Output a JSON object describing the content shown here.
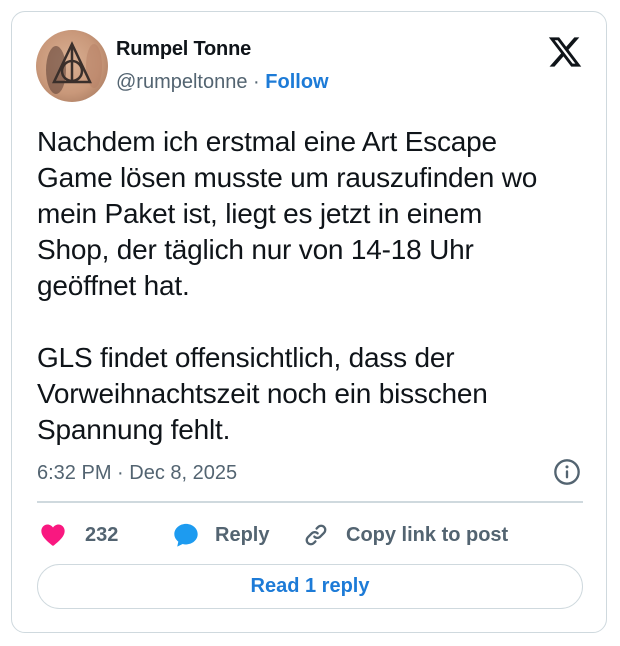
{
  "author": {
    "display_name": "Rumpel Tonne",
    "handle": "@rumpeltonne",
    "separator": "·",
    "follow_label": "Follow",
    "avatar_icon": "deathly-hallows-tattoo-icon"
  },
  "platform_logo": "x-logo-icon",
  "tweet": {
    "text": "Nachdem ich erstmal eine Art Escape\nGame lösen musste um rauszufinden wo\nmein Paket ist, liegt es jetzt in einem\nShop, der täglich nur von 14-18 Uhr\ngeöffnet hat.\n\nGLS findet offensichtlich, dass der\nVorweihnachtszeit noch ein bisschen\nSpannung fehlt.",
    "timestamp": "6:32 PM · Dec 8, 2025"
  },
  "actions": {
    "like_count": "232",
    "reply_label": "Reply",
    "copy_link_label": "Copy link to post"
  },
  "read_replies_label": "Read 1 reply",
  "colors": {
    "accent": "#1d7bd7",
    "like": "#f91880",
    "reply_icon": "#1d9bf0",
    "muted": "#536471",
    "border": "#cfd9de",
    "text": "#0f1419"
  }
}
